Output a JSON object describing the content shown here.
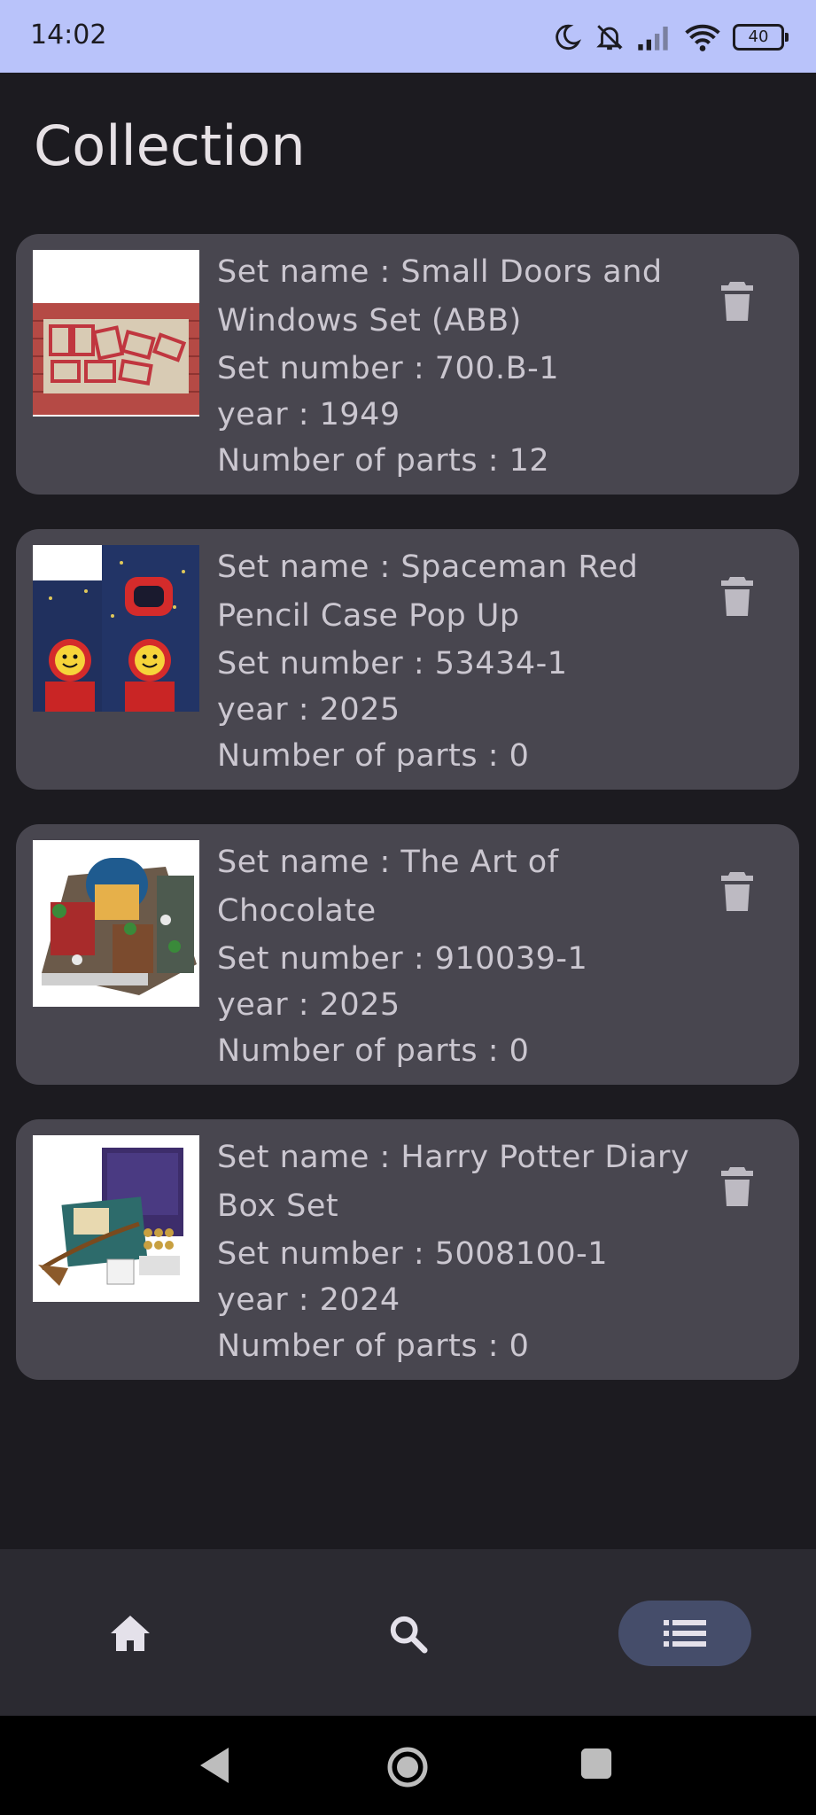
{
  "status_bar": {
    "time": "14:02",
    "battery": "40",
    "icons": [
      "moon-icon",
      "bell-off-icon",
      "signal-icon",
      "wifi-icon",
      "battery-icon"
    ]
  },
  "page": {
    "title": "Collection"
  },
  "sets": [
    {
      "name_line": "Set name : Small Doors and Windows Set (ABB)",
      "number_line": "Set number : 700.B-1",
      "year_line": "year : 1949",
      "parts_line": "Number of parts : 12",
      "image": "small-doors-windows-set"
    },
    {
      "name_line": "Set name : Spaceman Red Pencil Case Pop Up",
      "number_line": "Set number : 53434-1",
      "year_line": "year : 2025",
      "parts_line": "Number of parts : 0",
      "image": "spaceman-pencil-case"
    },
    {
      "name_line": "Set name : The Art of Chocolate",
      "number_line": "Set number : 910039-1",
      "year_line": "year : 2025",
      "parts_line": "Number of parts : 0",
      "image": "art-of-chocolate"
    },
    {
      "name_line": "Set name : Harry Potter Diary Box Set",
      "number_line": "Set number : 5008100-1",
      "year_line": "year : 2024",
      "parts_line": "Number of parts : 0",
      "image": "harry-potter-diary-box-set"
    }
  ],
  "bottom_nav": {
    "items": [
      {
        "icon": "home-icon",
        "selected": false
      },
      {
        "icon": "search-icon",
        "selected": false
      },
      {
        "icon": "list-icon",
        "selected": true
      }
    ]
  },
  "colors": {
    "status_bar": "#b9c3fa",
    "background": "#1c1b20",
    "card": "#48464f",
    "nav_bar": "#2b2a31",
    "nav_selected": "#454d6a",
    "text": "#cbc7d0"
  }
}
